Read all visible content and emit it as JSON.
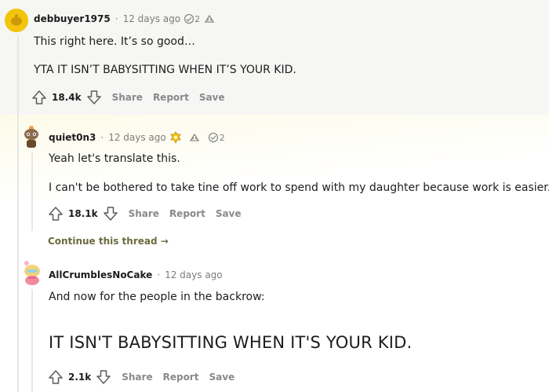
{
  "comments": [
    {
      "username": "debbuyer1975",
      "separator": "·",
      "time": "12 days ago",
      "award_count": "2",
      "lines": [
        "This right here. It’s so good…",
        "YTA IT ISN’T BABYSITTING WHEN IT’S YOUR KID."
      ],
      "score": "18.4k",
      "actions": [
        "Share",
        "Report",
        "Save"
      ]
    },
    {
      "username": "quiet0n3",
      "separator": "·",
      "time": "12 days ago",
      "award_count": "2",
      "lines": [
        "Yeah let's translate this.",
        "I can't be bothered to take tine off work to spend with my daughter because work is easier."
      ],
      "score": "18.1k",
      "actions": [
        "Share",
        "Report",
        "Save"
      ],
      "continue_label": "Continue this thread →"
    },
    {
      "username": "AllCrumblesNoCake",
      "separator": "·",
      "time": "12 days ago",
      "lines": [
        "And now for the people in the backrow:",
        "IT ISN'T BABYSITTING WHEN IT'S YOUR KID."
      ],
      "score": "2.1k",
      "actions": [
        "Share",
        "Report",
        "Save"
      ]
    }
  ],
  "colors": {
    "accent_text": "#6b6b3e",
    "muted": "#878a8c",
    "highlight_band": "#f6f6f4"
  },
  "icons": [
    "snoo-avatar-yellow",
    "award-icon",
    "upvote-icon",
    "downvote-icon",
    "continue-arrow"
  ]
}
